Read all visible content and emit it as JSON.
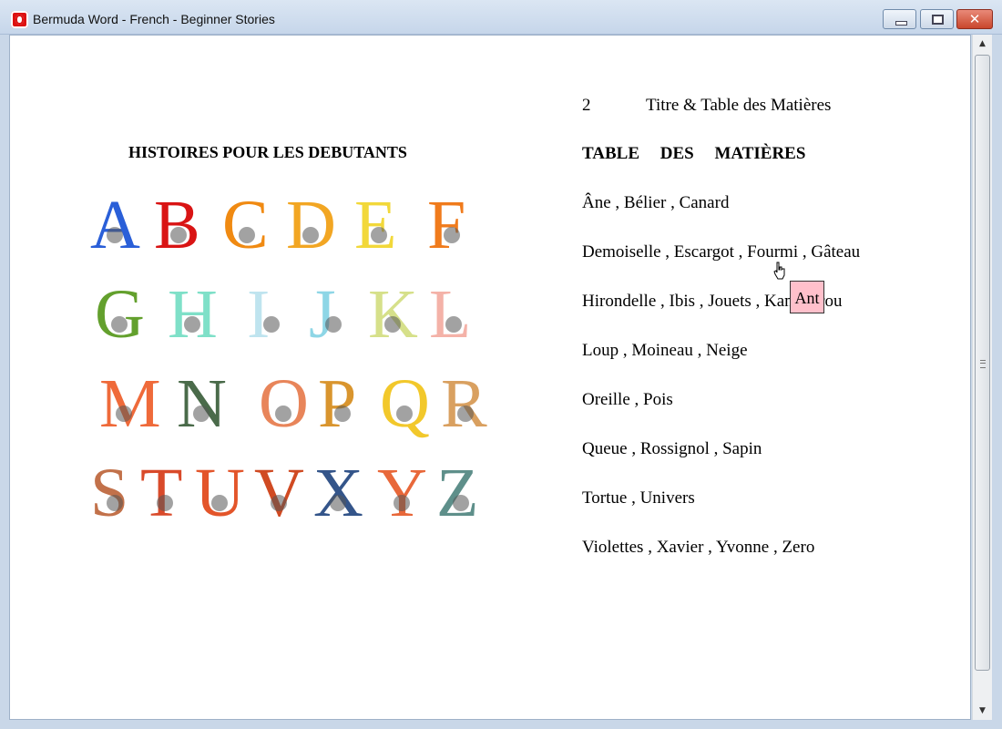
{
  "window": {
    "title": "Bermuda Word - French - Beginner Stories",
    "close_glyph": "✕"
  },
  "colors": {
    "tooltip_bg": "#ffc0cb",
    "title_bar": "#c6d6ea"
  },
  "left_page": {
    "title": "HISTOIRES POUR LES DEBUTANTS",
    "alphabet_rows": [
      [
        {
          "ch": "A",
          "color": "#2a5fd8"
        },
        {
          "ch": "B",
          "color": "#d91414"
        },
        {
          "ch": "C",
          "color": "#f08a12"
        },
        {
          "ch": "D",
          "color": "#f2a623"
        },
        {
          "ch": "E",
          "color": "#f2d83a"
        },
        {
          "ch": "F",
          "color": "#f07b1c"
        }
      ],
      [
        {
          "ch": "G",
          "color": "#63a02d"
        },
        {
          "ch": "H",
          "color": "#7fe0c8"
        },
        {
          "ch": "I",
          "color": "#bfe4ef"
        },
        {
          "ch": "J",
          "color": "#8ed6e6"
        },
        {
          "ch": "K",
          "color": "#d6e08a"
        },
        {
          "ch": "L",
          "color": "#f4b2a8"
        }
      ],
      [
        {
          "ch": "M",
          "color": "#ef6a3a"
        },
        {
          "ch": "N",
          "color": "#4a6b4a"
        },
        {
          "ch": "O",
          "color": "#e8855a"
        },
        {
          "ch": "P",
          "color": "#d9952e"
        },
        {
          "ch": "Q",
          "color": "#f2c82b"
        },
        {
          "ch": "R",
          "color": "#d9a060"
        }
      ],
      [
        {
          "ch": "S",
          "color": "#c2714a"
        },
        {
          "ch": "T",
          "color": "#d94a2a"
        },
        {
          "ch": "U",
          "color": "#e3552a"
        },
        {
          "ch": "V",
          "color": "#d04a22"
        },
        {
          "ch": "X",
          "color": "#34558a"
        },
        {
          "ch": "Y",
          "color": "#e8683a"
        },
        {
          "ch": "Z",
          "color": "#5e8f8a"
        }
      ]
    ]
  },
  "right_page": {
    "page_number": "2",
    "header": "Titre & Table des Matières",
    "toc_heading": "TABLE DES MATIÈRES",
    "toc_lines": [
      "Âne , Bélier , Canard",
      "Demoiselle , Escargot , Fourmi , Gâteau",
      "Hirondelle , Ibis , Jouets , Kangourou",
      "Loup , Moineau , Neige",
      "Oreille , Pois",
      "Queue , Rossignol , Sapin",
      "Tortue , Univers",
      "Violettes , Xavier , Yvonne , Zero"
    ]
  },
  "tooltip": {
    "text": "Ant"
  },
  "scrollbar": {
    "up_arrow": "▲",
    "down_arrow": "▼"
  }
}
